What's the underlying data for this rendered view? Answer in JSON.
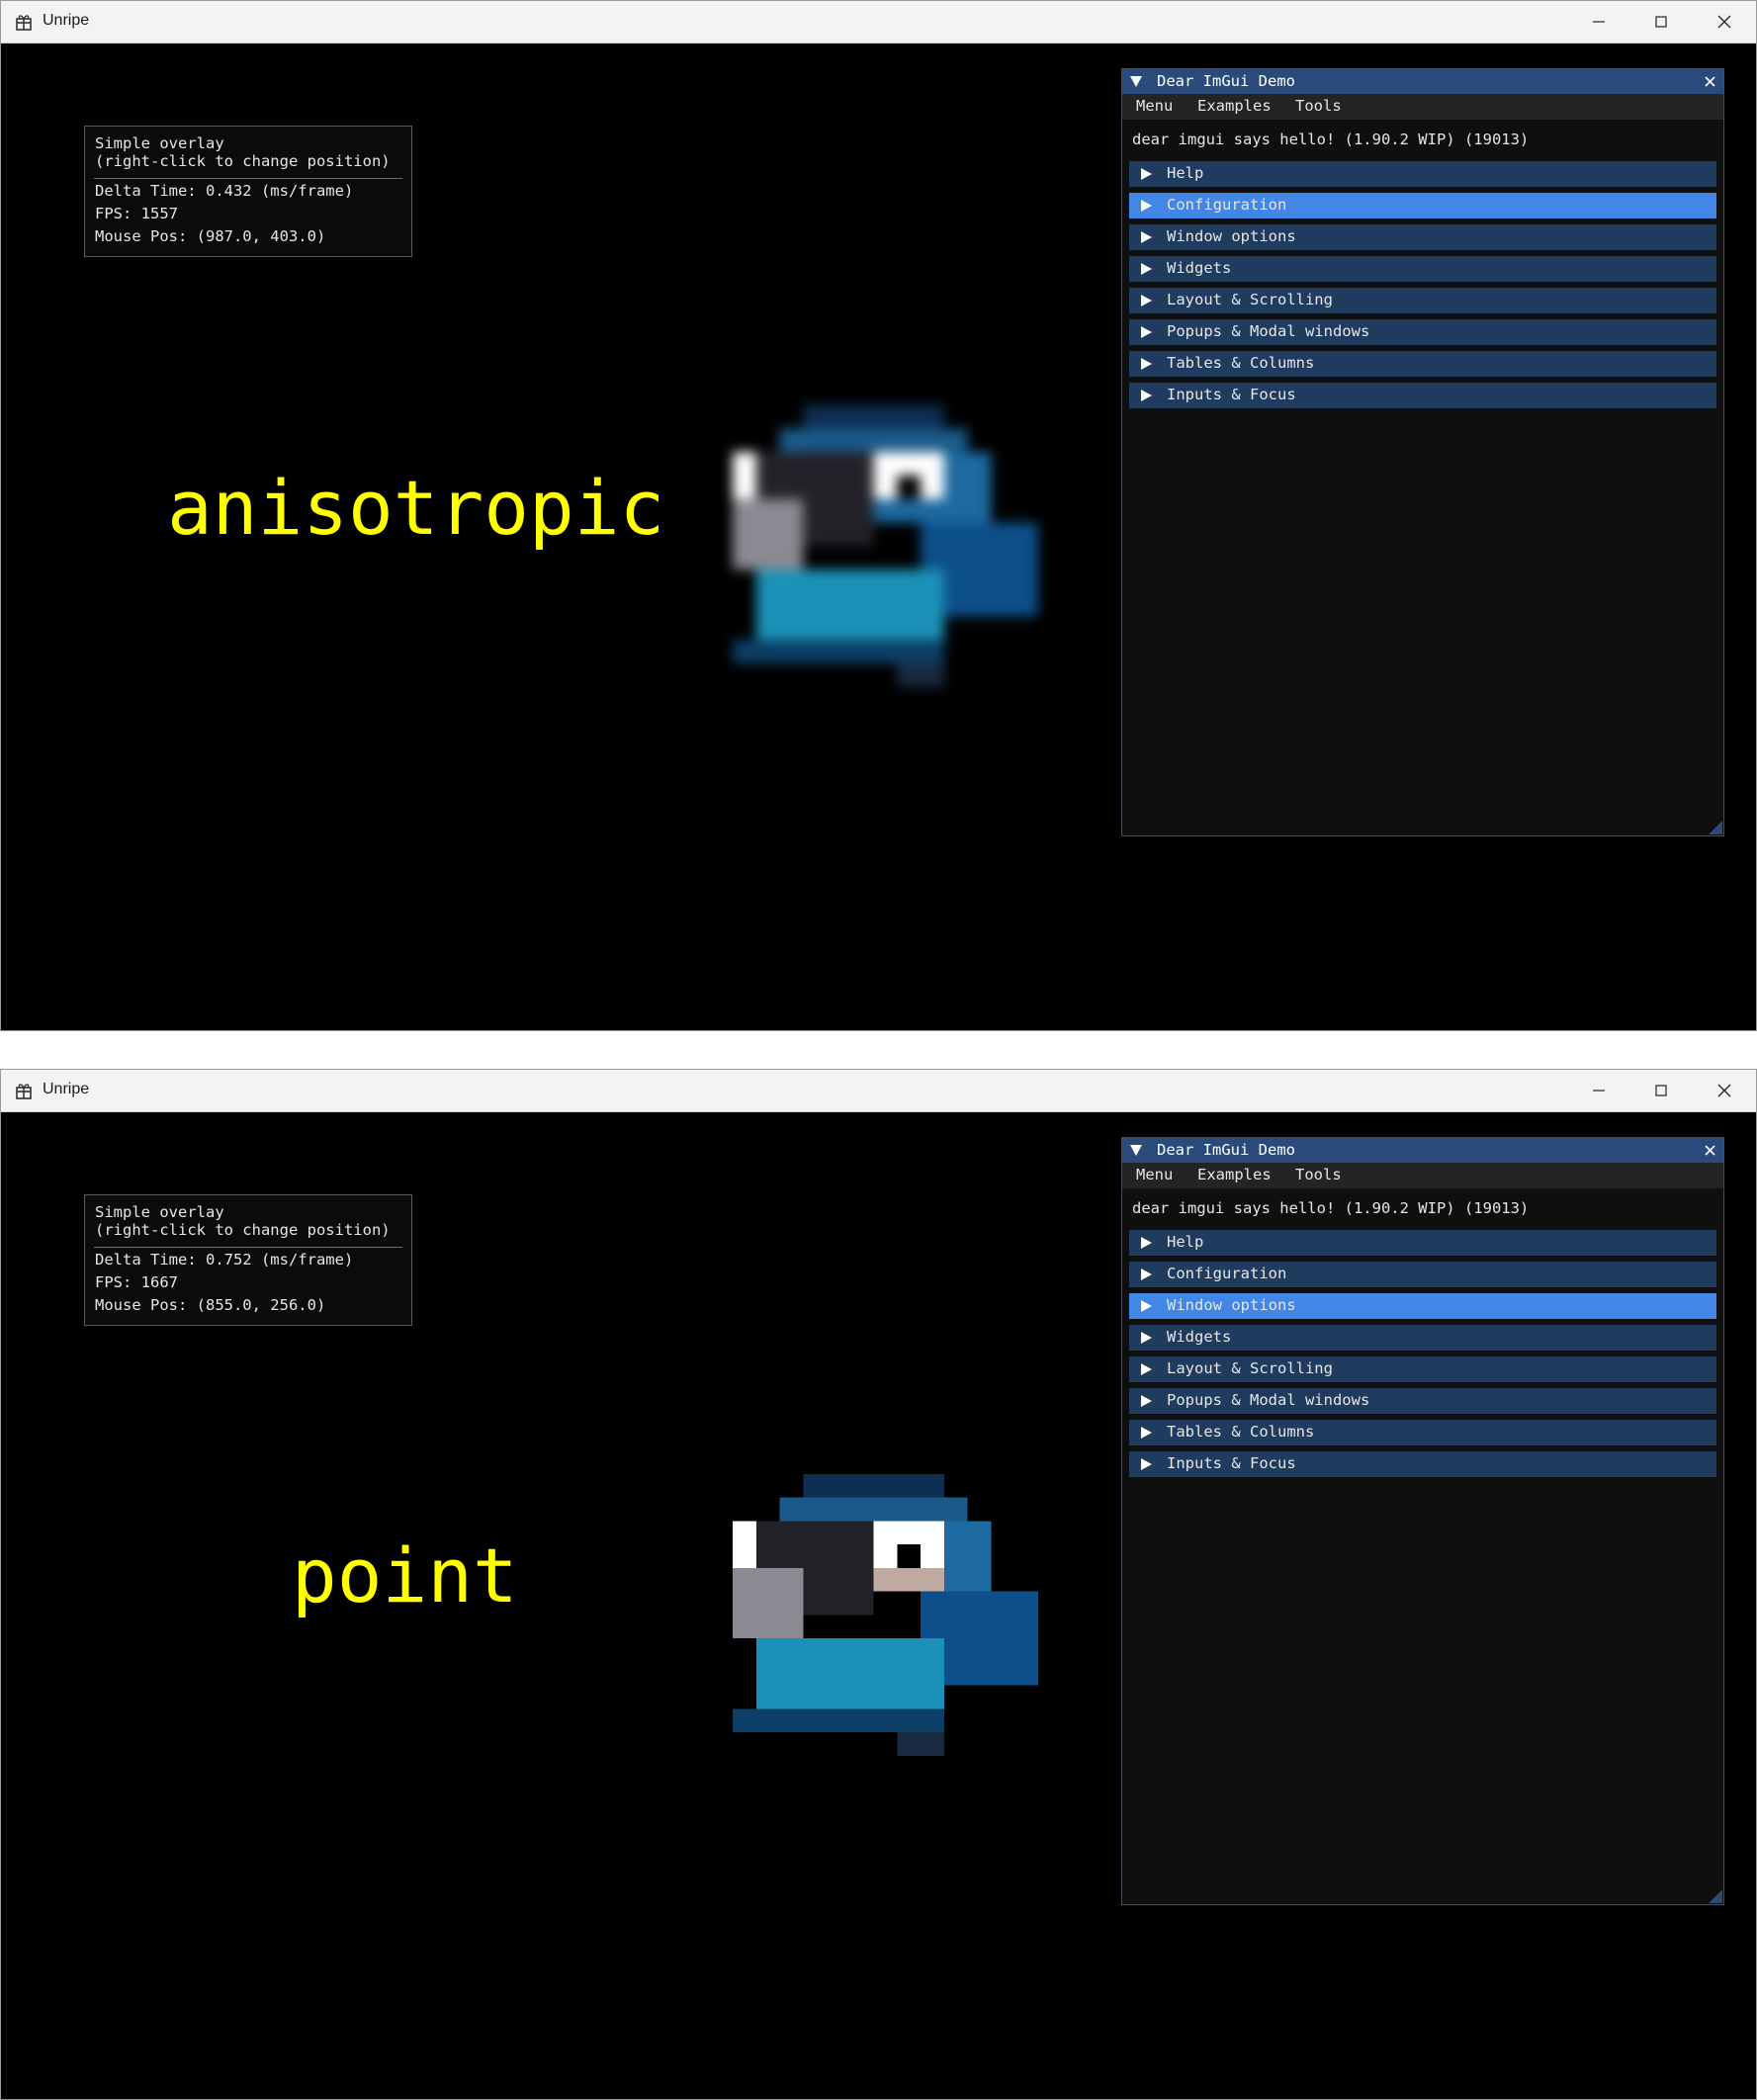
{
  "panels": [
    {
      "window": {
        "title": "Unripe"
      },
      "overlay": {
        "line1": "Simple overlay",
        "line2": "(right-click to change position)",
        "delta": "Delta Time: 0.432 (ms/frame)",
        "fps": "FPS: 1557",
        "mouse": "Mouse Pos: (987.0, 403.0)"
      },
      "mode_label": "anisotropic",
      "demo": {
        "title": "Dear ImGui Demo",
        "menu": [
          "Menu",
          "Examples",
          "Tools"
        ],
        "hello": "dear imgui says hello! (1.90.2 WIP) (19013)",
        "headers": [
          "Help",
          "Configuration",
          "Window options",
          "Widgets",
          "Layout & Scrolling",
          "Popups & Modal windows",
          "Tables & Columns",
          "Inputs & Focus"
        ],
        "active_header": "Configuration"
      }
    },
    {
      "window": {
        "title": "Unripe"
      },
      "overlay": {
        "line1": "Simple overlay",
        "line2": "(right-click to change position)",
        "delta": "Delta Time: 0.752 (ms/frame)",
        "fps": "FPS: 1667",
        "mouse": "Mouse Pos: (855.0, 256.0)"
      },
      "mode_label": "point",
      "demo": {
        "title": "Dear ImGui Demo",
        "menu": [
          "Menu",
          "Examples",
          "Tools"
        ],
        "hello": "dear imgui says hello! (1.90.2 WIP) (19013)",
        "headers": [
          "Help",
          "Configuration",
          "Window options",
          "Widgets",
          "Layout & Scrolling",
          "Popups & Modal windows",
          "Tables & Columns",
          "Inputs & Focus"
        ],
        "active_header": "Window options"
      }
    }
  ],
  "icons": {
    "app": "gift-box-icon",
    "minimize": "minimize-icon",
    "maximize": "maximize-icon",
    "close": "close-icon",
    "collapse": "collapse-triangle-icon",
    "tree": "tree-arrow-icon",
    "resize": "resize-grip-icon"
  },
  "colors": {
    "label": "#ffff00",
    "title_active": "#294a7a",
    "header": "#1f3b5e",
    "header_hover": "#4286e6",
    "window_bg": "#0f0f0f",
    "background": "#000000"
  }
}
